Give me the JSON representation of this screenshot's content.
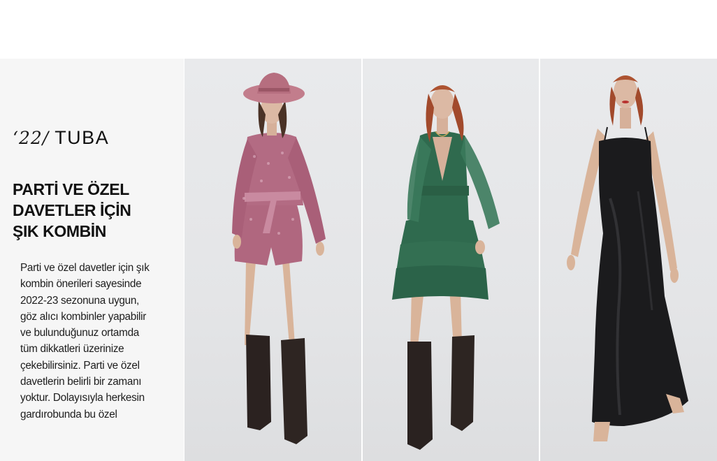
{
  "brand": {
    "year": "‘22/",
    "name": "TUBA"
  },
  "headline": {
    "lines": [
      "PARTİ VE ÖZEL",
      "DAVETLER İÇİN",
      "ŞIK KOMBİN"
    ]
  },
  "body": {
    "lines": [
      "Parti ve özel davetler için şık",
      "kombin önerileri sayesinde",
      "2022-23 sezonuna uygun,",
      "göz alıcı kombinler yapabilir",
      "ve bulunduğunuz ortamda",
      "tüm dikkatleri üzerinize",
      "çekebilirsiniz. Parti ve özel",
      "davetlerin belirli bir zamanı",
      "yoktur. Dolayısıyla herkesin",
      "gardırobunda bu özel"
    ]
  },
  "photos": [
    {
      "name": "pink-sequin-playsuit-photo",
      "outfit": "pink sequin wrap playsuit, pink fedora hat, black knee-high boots",
      "color": "#b0677f"
    },
    {
      "name": "green-ruffle-dress-photo",
      "outfit": "green tiered ruffle mini dress, black knee-high boots",
      "color": "#2f6a4e"
    },
    {
      "name": "black-satin-gown-photo",
      "outfit": "black satin slip maxi dress, black strappy heels",
      "color": "#1b1b1d"
    }
  ]
}
